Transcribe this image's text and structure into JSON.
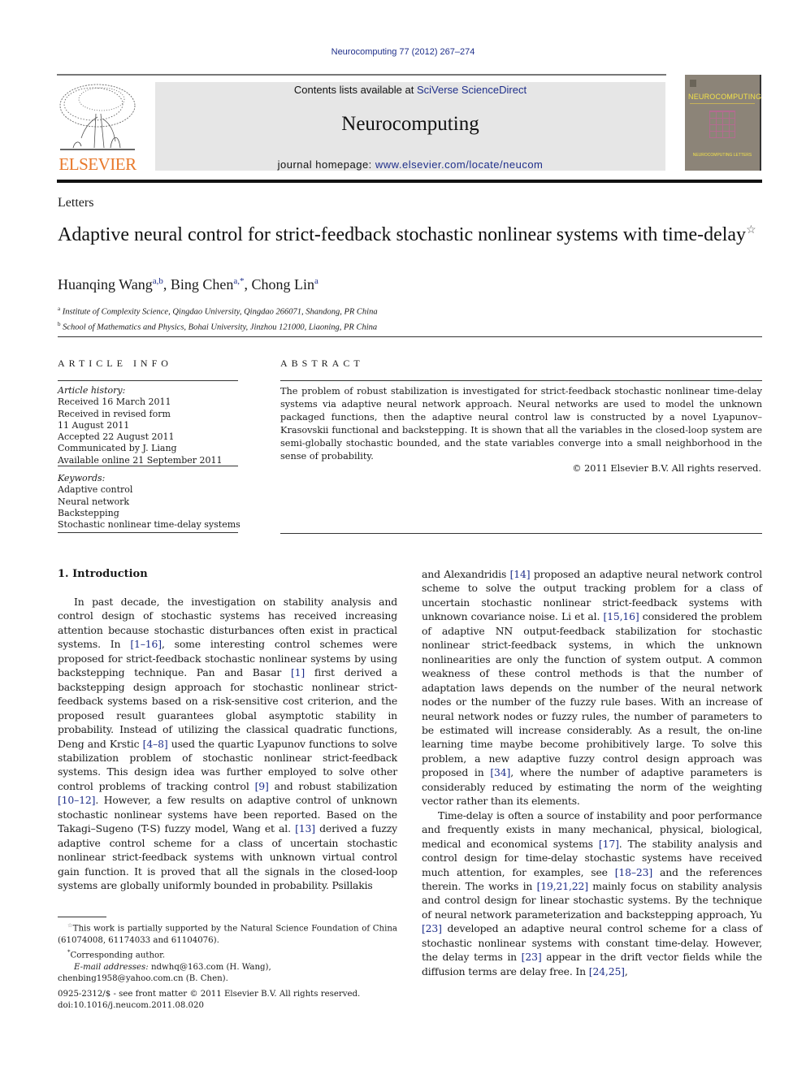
{
  "header": {
    "citation": "Neurocomputing 77 (2012) 267–274",
    "contents_prefix": "Contents lists available at ",
    "contents_link": "SciVerse ScienceDirect",
    "journal_name": "Neurocomputing",
    "homepage_prefix": "journal homepage: ",
    "homepage_link": "www.elsevier.com/locate/neucom",
    "publisher_logo_text": "ELSEVIER",
    "cover_title": "NEUROCOMPUTING",
    "cover_subtitle": "NEUROCOMPUTING LETTERS"
  },
  "article": {
    "section_label": "Letters",
    "title": "Adaptive neural control for strict-feedback stochastic nonlinear systems with time-delay",
    "title_note_mark": "☆",
    "authors": [
      {
        "name": "Huanqing Wang",
        "affil": "a,b"
      },
      {
        "name": "Bing Chen",
        "affil": "a,*"
      },
      {
        "name": "Chong Lin",
        "affil": "a"
      }
    ],
    "affiliations": [
      {
        "mark": "a",
        "text": "Institute of Complexity Science, Qingdao University, Qingdao 266071, Shandong, PR China"
      },
      {
        "mark": "b",
        "text": "School of Mathematics and Physics, Bohai University, Jinzhou 121000, Liaoning, PR China"
      }
    ]
  },
  "article_info": {
    "heading": "ARTICLE INFO",
    "history_label": "Article history:",
    "history": [
      "Received 16 March 2011",
      "Received in revised form",
      "11 August 2011",
      "Accepted 22 August 2011",
      "Communicated by J. Liang",
      "Available online 21 September 2011"
    ],
    "keywords_label": "Keywords:",
    "keywords": [
      "Adaptive control",
      "Neural network",
      "Backstepping",
      "Stochastic nonlinear time-delay systems"
    ]
  },
  "abstract": {
    "heading": "ABSTRACT",
    "text": "The problem of robust stabilization is investigated for strict-feedback stochastic nonlinear time-delay systems via adaptive neural network approach. Neural networks are used to model the unknown packaged functions, then the adaptive neural control law is constructed by a novel Lyapunov–Krasovskii functional and backstepping. It is shown that all the variables in the closed-loop system are semi-globally stochastic bounded, and the state variables converge into a small neighborhood in the sense of probability.",
    "copyright": "© 2011 Elsevier B.V. All rights reserved."
  },
  "introduction": {
    "heading": "1.  Introduction",
    "left_p1": [
      {
        "t": "In past decade, the investigation on stability analysis and control design of stochastic systems has received increasing attention because stochastic disturbances often exist in practical systems. In "
      },
      {
        "ref": "[1–16]"
      },
      {
        "t": ", some interesting control schemes were proposed for strict-feedback stochastic nonlinear systems by using backstepping technique. Pan and Basar "
      },
      {
        "ref": "[1]"
      },
      {
        "t": " first derived a backstepping design approach for stochastic nonlinear strict-feedback systems based on a risk-sensitive cost criterion, and the proposed result guarantees global asymptotic stability in probability. Instead of utilizing the classical quadratic functions, Deng and Krstic "
      },
      {
        "ref": "[4–8]"
      },
      {
        "t": " used the quartic Lyapunov functions to solve stabilization problem of stochastic nonlinear strict-feedback systems. This design idea was further employed to solve other control problems of tracking control "
      },
      {
        "ref": "[9]"
      },
      {
        "t": " and robust stabilization "
      },
      {
        "ref": "[10–12]"
      },
      {
        "t": ". However, a few results on adaptive control of unknown stochastic nonlinear systems have been reported. Based on the Takagi–Sugeno (T-S) fuzzy model, Wang et al. "
      },
      {
        "ref": "[13]"
      },
      {
        "t": " derived a fuzzy adaptive control scheme for a class of uncertain stochastic nonlinear strict-feedback systems with unknown virtual control gain function. It is proved that all the signals in the closed-loop systems are globally uniformly bounded in probability. Psillakis"
      }
    ],
    "right_p1": [
      {
        "t": "and Alexandridis "
      },
      {
        "ref": "[14]"
      },
      {
        "t": " proposed an adaptive neural network control scheme to solve the output tracking problem for a class of uncertain stochastic nonlinear strict-feedback systems with unknown covariance noise. Li et al. "
      },
      {
        "ref": "[15,16]"
      },
      {
        "t": " considered the problem of adaptive NN output-feedback stabilization for stochastic nonlinear strict-feedback systems, in which the unknown nonlinearities are only the function of system output. A common weakness of these control methods is that the number of adaptation laws depends on the number of the neural network nodes or the number of the fuzzy rule bases. With an increase of neural network nodes or fuzzy rules, the number of parameters to be estimated will increase considerably. As a result, the on-line learning time maybe become prohibitively large. To solve this problem, a new adaptive fuzzy control design approach was proposed in "
      },
      {
        "ref": "[34]"
      },
      {
        "t": ", where the number of adaptive parameters is considerably reduced by estimating the norm of the weighting vector rather than its elements."
      }
    ],
    "right_p2": [
      {
        "t": "Time-delay is often a source of instability and poor performance and frequently exists in many mechanical, physical, biological, medical and economical systems "
      },
      {
        "ref": "[17]"
      },
      {
        "t": ". The stability analysis and control design for time-delay stochastic systems have received much attention, for examples, see "
      },
      {
        "ref": "[18–23]"
      },
      {
        "t": " and the references therein. The works in "
      },
      {
        "ref": "[19,21,22]"
      },
      {
        "t": " mainly focus on stability analysis and control design for linear stochastic systems. By the technique of neural network parameterization and backstepping approach, Yu "
      },
      {
        "ref": "[23]"
      },
      {
        "t": " developed an adaptive neural control scheme for a class of stochastic nonlinear systems with constant time-delay. However, the delay terms in "
      },
      {
        "ref": "[23]"
      },
      {
        "t": " appear in the drift vector fields while the diffusion terms are delay free. In "
      },
      {
        "ref": "[24,25]"
      },
      {
        "t": ","
      }
    ]
  },
  "footnotes": {
    "funding_mark": "☆",
    "funding": "This work is partially supported by the Natural Science Foundation of China (61074008, 61174033 and 61104076).",
    "corresponding_mark": "*",
    "corresponding": "Corresponding author.",
    "email_label": "E-mail addresses:",
    "email1": "ndwhq@163.com (H. Wang),",
    "email2": "chenbing1958@yahoo.com.cn (B. Chen).",
    "issn": "0925-2312/$ - see front matter © 2011 Elsevier B.V. All rights reserved.",
    "doi": "doi:10.1016/j.neucom.2011.08.020"
  },
  "colors": {
    "link": "#1f2f8a",
    "publisher_orange": "#e8782a",
    "header_box": "#e6e6e6"
  }
}
